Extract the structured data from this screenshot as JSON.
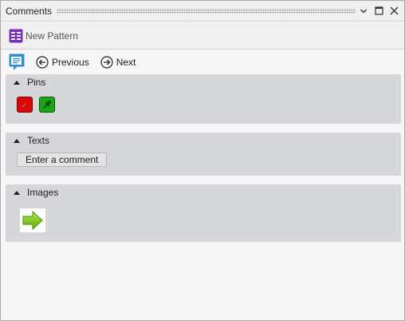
{
  "window": {
    "title": "Comments"
  },
  "title_buttons": {
    "dropdown_icon": "chevron-down-icon",
    "maximize_icon": "maximize-icon",
    "close_icon": "close-icon"
  },
  "toolbar": {
    "new_pattern_label": "New Pattern",
    "new_pattern_icon": "pattern-grid-icon",
    "accent": "#7b2fbf"
  },
  "nav": {
    "comment_icon": "speech-bubble-icon",
    "previous_label": "Previous",
    "next_label": "Next"
  },
  "sections": {
    "pins": {
      "title": "Pins",
      "items": [
        {
          "name": "red-pin",
          "color": "#d9090b"
        },
        {
          "name": "green-pin",
          "color": "#17a717"
        }
      ]
    },
    "texts": {
      "title": "Texts",
      "button_label": "Enter a comment"
    },
    "images": {
      "title": "Images",
      "items": [
        {
          "name": "green-arrow-image",
          "color": "#7ac416"
        }
      ]
    }
  }
}
